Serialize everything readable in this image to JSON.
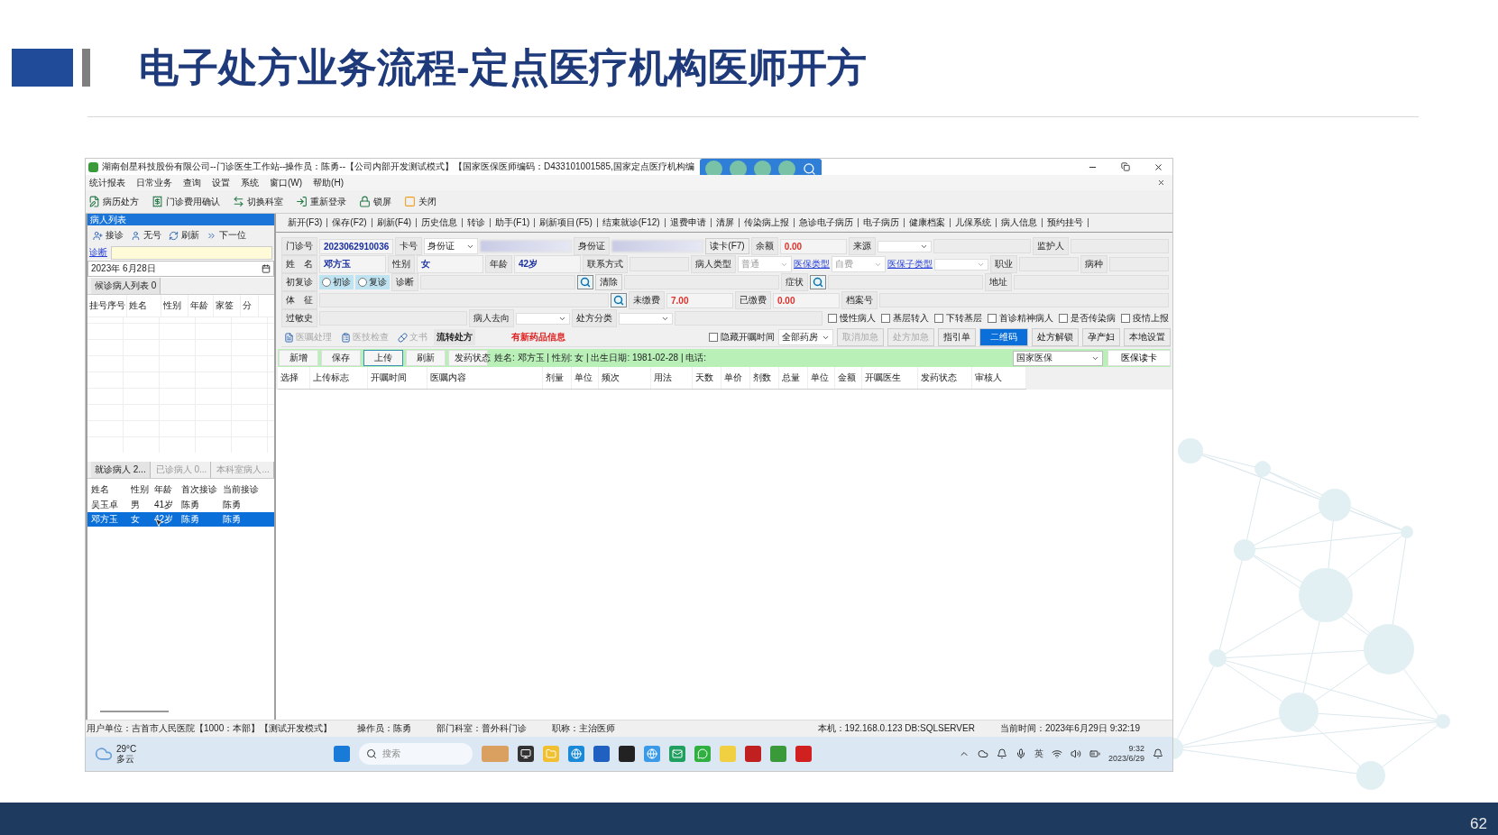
{
  "slide": {
    "title": "电子处方业务流程-定点医疗机构医师开方",
    "page_number": "62"
  },
  "app": {
    "title": "湖南创星科技股份有限公司--门诊医生工作站--操作员：陈勇--【公司内部开发测试模式】【国家医保医师编码：D433101001585,国家定点医疗机构编",
    "menu": [
      "统计报表",
      "日常业务",
      "查询",
      "设置",
      "系统",
      "窗口(W)",
      "帮助(H)"
    ],
    "toolbar": [
      "病历处方",
      "门诊费用确认",
      "切换科室",
      "重新登录",
      "锁屏",
      "关闭"
    ],
    "patient_panel": {
      "header": "病人列表",
      "actions": [
        "接诊",
        "无号",
        "刷新",
        "下一位"
      ],
      "diagnosis_link": "诊断",
      "date": "2023年 6月28日",
      "waiting_tab": "候诊病人列表 0",
      "waiting_columns": [
        "挂号序号",
        "姓名",
        "性别",
        "年龄",
        "家签",
        "分"
      ],
      "tabs": [
        {
          "label": "就诊病人  2...",
          "selected": true
        },
        {
          "label": "已诊病人  0...",
          "selected": false
        },
        {
          "label": "本科室病人...",
          "selected": false
        }
      ],
      "columns": [
        "姓名",
        "性别",
        "年龄",
        "首次接诊",
        "当前接诊"
      ],
      "rows": [
        {
          "cells": [
            "吴玉卓",
            "男",
            "41岁",
            "陈勇",
            "陈勇"
          ],
          "selected": false
        },
        {
          "cells": [
            "邓方玉",
            "女",
            "42岁",
            "陈勇",
            "陈勇"
          ],
          "selected": true
        }
      ]
    },
    "function_bar": [
      "新开(F3)",
      "保存(F2)",
      "刷新(F4)",
      "历史信息",
      "转诊",
      "助手(F1)",
      "刷新项目(F5)",
      "结束就诊(F12)",
      "退费申请",
      "清屏",
      "传染病上报",
      "急诊电子病历",
      "电子病历",
      "健康档案",
      "儿保系统",
      "病人信息",
      "预约挂号"
    ],
    "form_rows": [
      [
        {
          "kind": "label",
          "text": "门诊号"
        },
        {
          "kind": "value",
          "text": "2023062910036"
        },
        {
          "kind": "label",
          "text": "卡号"
        },
        {
          "kind": "select",
          "text": "身份证",
          "disabled": false
        },
        {
          "kind": "masked"
        },
        {
          "kind": "label",
          "text": "身份证"
        },
        {
          "kind": "masked"
        },
        {
          "kind": "button",
          "text": "读卡(F7)"
        },
        {
          "kind": "label",
          "text": "余额"
        },
        {
          "kind": "money",
          "text": "0.00"
        },
        {
          "kind": "label",
          "text": "来源"
        },
        {
          "kind": "select",
          "disabled": false
        },
        {
          "kind": "blank"
        },
        {
          "kind": "label",
          "text": "监护人"
        },
        {
          "kind": "blank"
        }
      ],
      [
        {
          "kind": "label",
          "text": "姓　名"
        },
        {
          "kind": "value",
          "text": "邓方玉"
        },
        {
          "kind": "label",
          "text": "性别"
        },
        {
          "kind": "value",
          "text": "女"
        },
        {
          "kind": "label",
          "text": "年龄"
        },
        {
          "kind": "value",
          "text": "42岁"
        },
        {
          "kind": "label",
          "text": "联系方式"
        },
        {
          "kind": "blank"
        },
        {
          "kind": "label",
          "text": "病人类型"
        },
        {
          "kind": "select",
          "text": "普通",
          "disabled": true
        },
        {
          "kind": "link",
          "text": "医保类型"
        },
        {
          "kind": "select",
          "text": "自费",
          "disabled": true
        },
        {
          "kind": "link",
          "text": "医保子类型"
        },
        {
          "kind": "select",
          "disabled": true
        },
        {
          "kind": "label",
          "text": "职业"
        },
        {
          "kind": "blank"
        },
        {
          "kind": "label",
          "text": "病种"
        },
        {
          "kind": "blank"
        }
      ],
      [
        {
          "kind": "label",
          "text": "初复诊"
        },
        {
          "kind": "radio",
          "text": "初诊",
          "selected": false
        },
        {
          "kind": "radio",
          "text": "复诊",
          "selected": false
        },
        {
          "kind": "label",
          "text": "诊断"
        },
        {
          "kind": "blank"
        },
        {
          "kind": "search"
        },
        {
          "kind": "button",
          "text": "清除"
        },
        {
          "kind": "blank"
        },
        {
          "kind": "label",
          "text": "症状"
        },
        {
          "kind": "search"
        },
        {
          "kind": "blank"
        },
        {
          "kind": "label",
          "text": "地址"
        },
        {
          "kind": "blank"
        }
      ],
      [
        {
          "kind": "label",
          "text": "体　征"
        },
        {
          "kind": "blank"
        },
        {
          "kind": "search"
        },
        {
          "kind": "label",
          "text": "未缴费"
        },
        {
          "kind": "money",
          "text": "7.00"
        },
        {
          "kind": "label",
          "text": "已缴费"
        },
        {
          "kind": "money",
          "text": "0.00"
        },
        {
          "kind": "label",
          "text": "档案号"
        },
        {
          "kind": "blank"
        }
      ],
      [
        {
          "kind": "label",
          "text": "过敏史"
        },
        {
          "kind": "blank"
        },
        {
          "kind": "label",
          "text": "病人去向"
        },
        {
          "kind": "select",
          "disabled": false
        },
        {
          "kind": "label",
          "text": "处方分类"
        },
        {
          "kind": "select",
          "disabled": false
        },
        {
          "kind": "blank"
        },
        {
          "kind": "checkbox",
          "text": "慢性病人",
          "checked": false
        },
        {
          "kind": "checkbox",
          "text": "基层转入",
          "checked": false
        },
        {
          "kind": "checkbox",
          "text": "下转基层",
          "checked": false
        },
        {
          "kind": "checkbox",
          "text": "首诊精神病人",
          "checked": false
        },
        {
          "kind": "checkbox",
          "text": "是否传染病",
          "checked": false
        },
        {
          "kind": "checkbox",
          "text": "疫情上报",
          "checked": false
        }
      ]
    ],
    "order_tabs": [
      {
        "label": "医嘱处理",
        "selected": false
      },
      {
        "label": "医技检查",
        "selected": false
      },
      {
        "label": "文书",
        "selected": false
      },
      {
        "label": "流转处方",
        "selected": true
      }
    ],
    "notice": "有新药品信息",
    "hide_time": {
      "label": "隐藏开嘱时间",
      "checked": false
    },
    "pharmacy": "全部药房",
    "order_buttons": [
      {
        "label": "取消加急",
        "disabled": true,
        "selected": false
      },
      {
        "label": "处方加急",
        "disabled": true,
        "selected": false
      },
      {
        "label": "指引单",
        "disabled": false,
        "selected": false
      },
      {
        "label": "二维码",
        "disabled": false,
        "selected": true
      },
      {
        "label": "处方解锁",
        "disabled": false,
        "selected": false
      },
      {
        "label": "孕产妇",
        "disabled": false,
        "selected": false
      },
      {
        "label": "本地设置",
        "disabled": false,
        "selected": false
      }
    ],
    "actions": [
      {
        "label": "新增",
        "focused": false
      },
      {
        "label": "保存",
        "focused": false
      },
      {
        "label": "上传",
        "focused": true
      },
      {
        "label": "刷新",
        "focused": false
      },
      {
        "label": "发药状态",
        "focused": false
      }
    ],
    "patient_info": "姓名: 邓方玉  |  性别: 女  |  出生日期: 1981-02-28  |  电话:",
    "insurance": "国家医保",
    "card_button": "医保读卡",
    "columns": [
      "选择",
      "上传标志",
      "开嘱时间",
      "医嘱内容",
      "剂量",
      "单位",
      "频次",
      "用法",
      "天数",
      "单价",
      "剂数",
      "总量",
      "单位",
      "金额",
      "开嘱医生",
      "发药状态",
      "审核人"
    ],
    "status_bar": [
      "用户单位：吉首市人民医院【1000：本部】【测试开发模式】",
      "操作员：陈勇",
      "部门科室：普外科门诊",
      "职称：主治医师",
      "本机：192.168.0.123 DB:SQLSERVER",
      "当前时间：2023年6月29日 9:32:19"
    ],
    "taskbar": {
      "temperature": "29°C",
      "weather": "多云",
      "search_placeholder": "搜索",
      "ime": "英",
      "time": "9:32",
      "date": "2023/6/29"
    }
  }
}
